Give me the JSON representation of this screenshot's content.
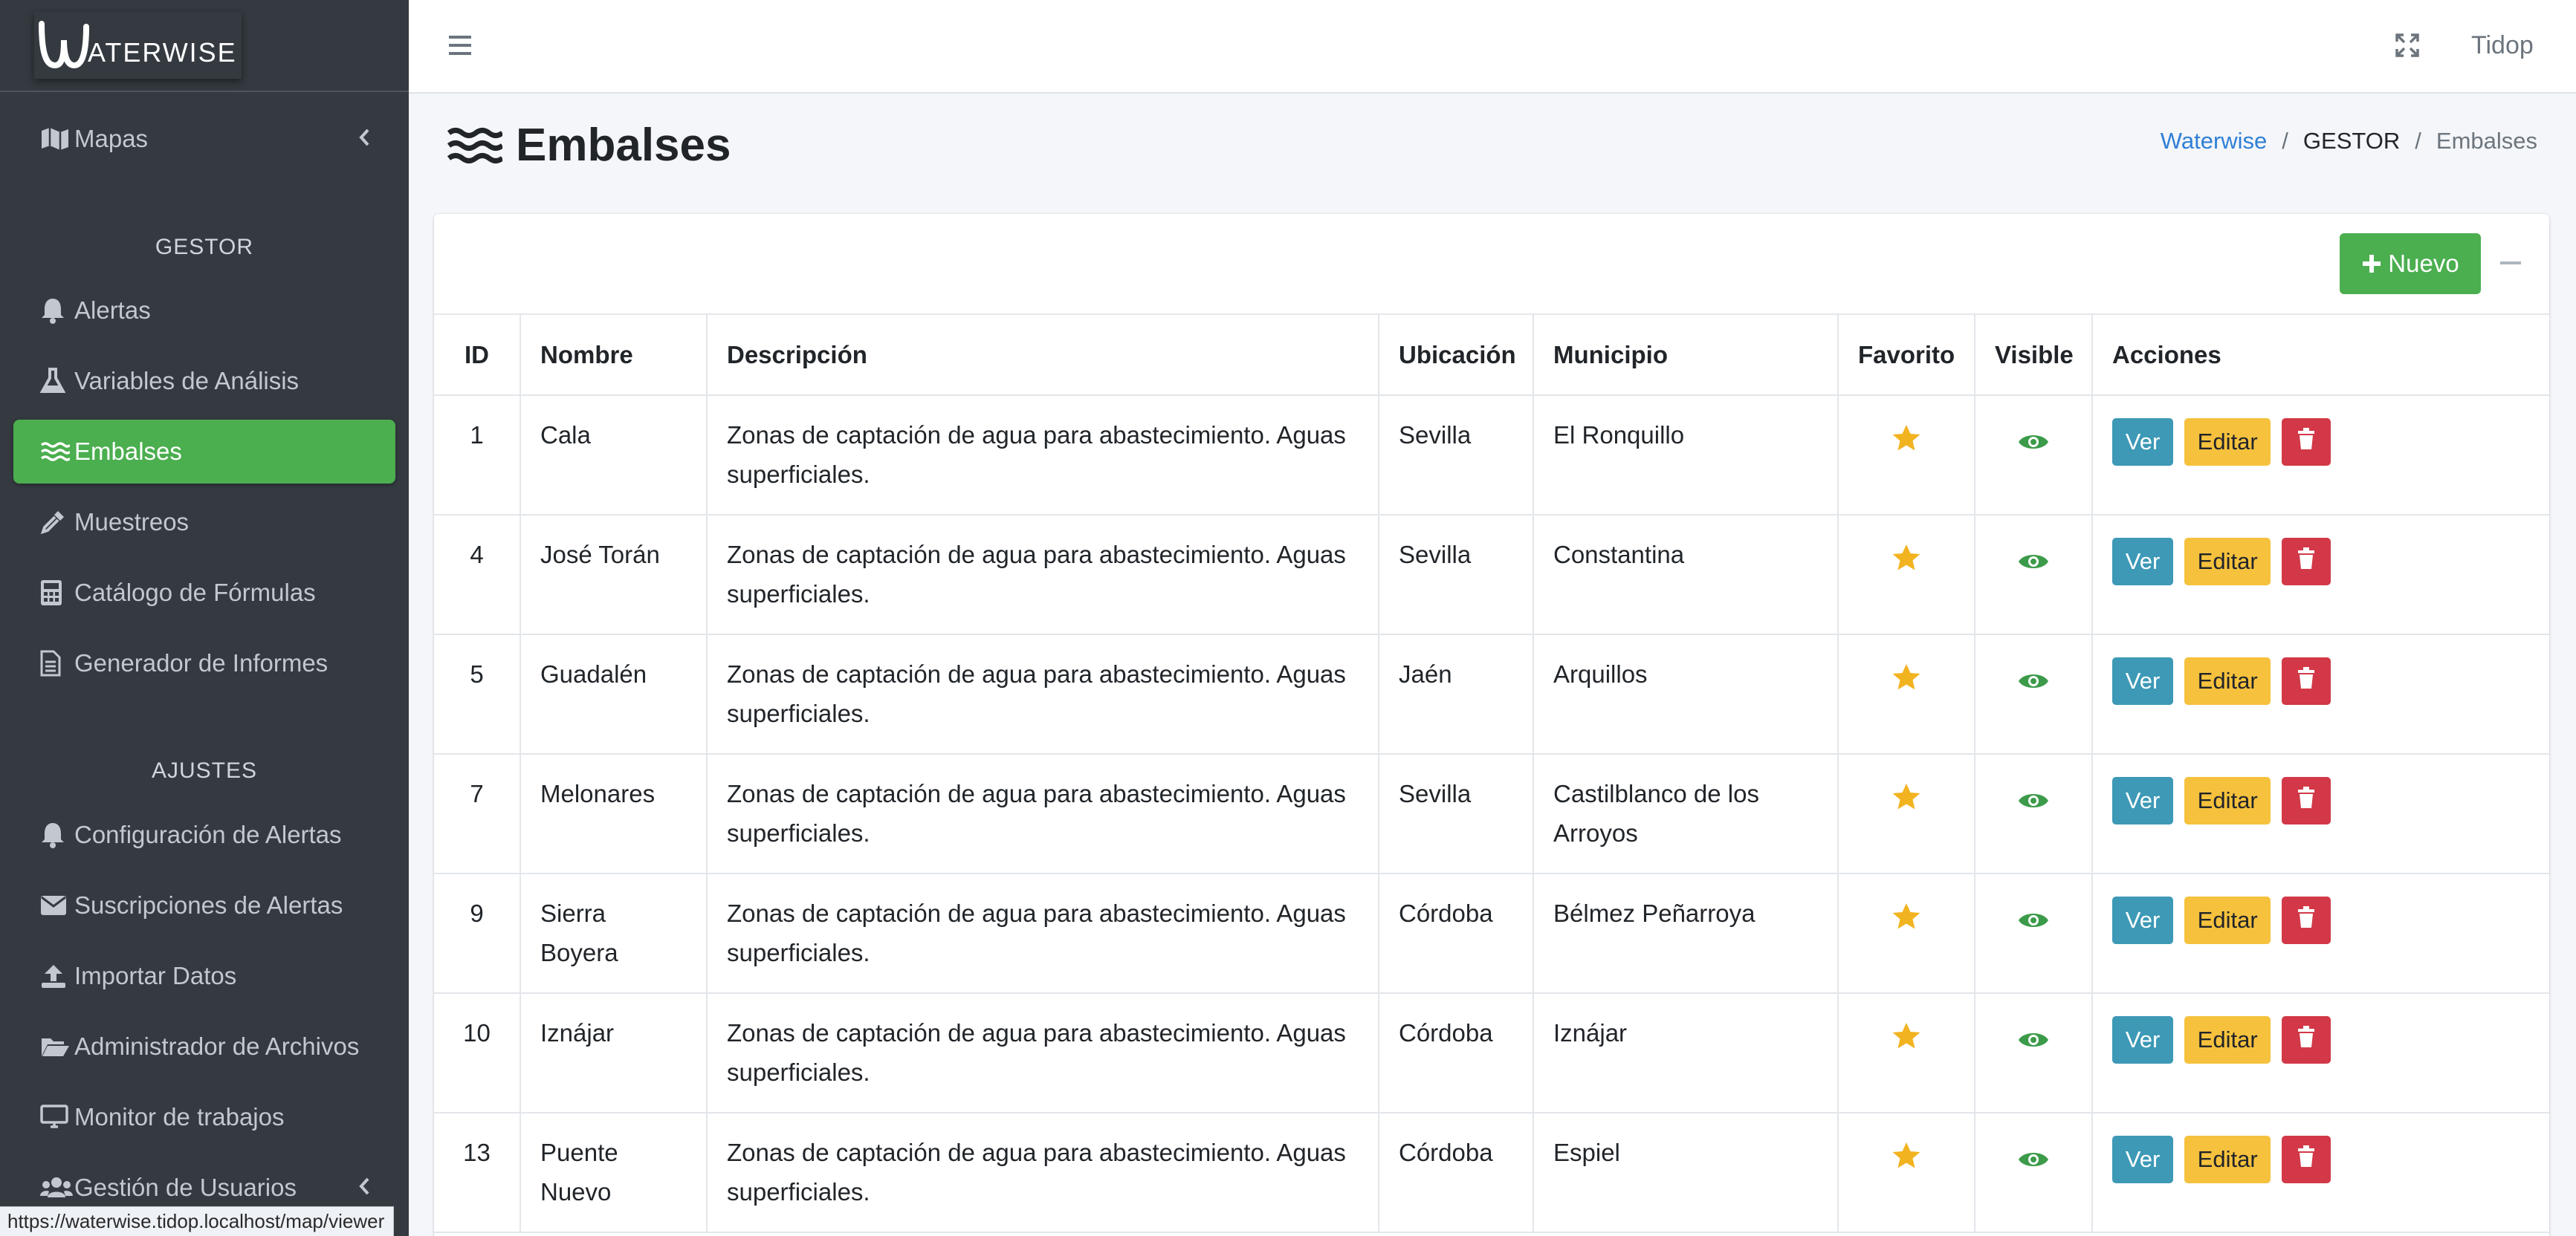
{
  "brand": {
    "name": "ATERWISE"
  },
  "sidebar": {
    "top_items": [
      {
        "label": "Mapas",
        "icon": "map-icon"
      }
    ],
    "section_gestor": "GESTOR",
    "gestor_items": [
      {
        "label": "Alertas",
        "icon": "bell-icon"
      },
      {
        "label": "Variables de Análisis",
        "icon": "flask-icon"
      },
      {
        "label": "Embalses",
        "icon": "water-icon"
      },
      {
        "label": "Muestreos",
        "icon": "eyedropper-icon"
      },
      {
        "label": "Catálogo de Fórmulas",
        "icon": "calculator-icon"
      },
      {
        "label": "Generador de Informes",
        "icon": "file-icon"
      }
    ],
    "section_ajustes": "AJUSTES",
    "ajustes_items": [
      {
        "label": "Configuración de Alertas",
        "icon": "bell-icon"
      },
      {
        "label": "Suscripciones de Alertas",
        "icon": "envelope-icon"
      },
      {
        "label": "Importar Datos",
        "icon": "upload-icon"
      },
      {
        "label": "Administrador de Archivos",
        "icon": "folder-open-icon"
      },
      {
        "label": "Monitor de trabajos",
        "icon": "desktop-icon"
      },
      {
        "label": "Gestión de Usuarios",
        "icon": "users-icon"
      }
    ],
    "active_label": "Embalses"
  },
  "topbar": {
    "user": "Tidop"
  },
  "page": {
    "title": "Embalses"
  },
  "breadcrumb": {
    "root": "Waterwise",
    "middle": "GESTOR",
    "current": "Embalses"
  },
  "card": {
    "new_button": "Nuevo"
  },
  "table": {
    "headers": [
      "ID",
      "Nombre",
      "Descripción",
      "Ubicación",
      "Municipio",
      "Favorito",
      "Visible",
      "Acciones"
    ],
    "rows": [
      {
        "id": "1",
        "nombre": "Cala",
        "descripcion": "Zonas de captación de agua para abastecimiento. Aguas superficiales.",
        "ubicacion": "Sevilla",
        "municipio": "El Ronquillo"
      },
      {
        "id": "4",
        "nombre": "José Torán",
        "descripcion": "Zonas de captación de agua para abastecimiento. Aguas superficiales.",
        "ubicacion": "Sevilla",
        "municipio": "Constantina"
      },
      {
        "id": "5",
        "nombre": "Guadalén",
        "descripcion": "Zonas de captación de agua para abastecimiento. Aguas superficiales.",
        "ubicacion": "Jaén",
        "municipio": "Arquillos"
      },
      {
        "id": "7",
        "nombre": "Melonares",
        "descripcion": "Zonas de captación de agua para abastecimiento. Aguas superficiales.",
        "ubicacion": "Sevilla",
        "municipio": "Castilblanco de los Arroyos"
      },
      {
        "id": "9",
        "nombre": "Sierra Boyera",
        "descripcion": "Zonas de captación de agua para abastecimiento. Aguas superficiales.",
        "ubicacion": "Córdoba",
        "municipio": "Bélmez Peñarroya"
      },
      {
        "id": "10",
        "nombre": "Iznájar",
        "descripcion": "Zonas de captación de agua para abastecimiento. Aguas superficiales.",
        "ubicacion": "Córdoba",
        "municipio": "Iznájar"
      },
      {
        "id": "13",
        "nombre": "Puente Nuevo",
        "descripcion": "Zonas de captación de agua para abastecimiento. Aguas superficiales.",
        "ubicacion": "Córdoba",
        "municipio": "Espiel"
      }
    ],
    "actions": {
      "view": "Ver",
      "edit": "Editar"
    }
  },
  "statusbar": {
    "url": "https://waterwise.tidop.localhost/map/viewer"
  },
  "colors": {
    "sidebar_bg": "#343a40",
    "active_green": "#4bae4f",
    "star": "#f2b320",
    "eye": "#3c9b4a",
    "btn_info": "#3d99b6",
    "btn_warning": "#f6c13d",
    "btn_danger": "#d23847",
    "link": "#2f7fd6"
  }
}
